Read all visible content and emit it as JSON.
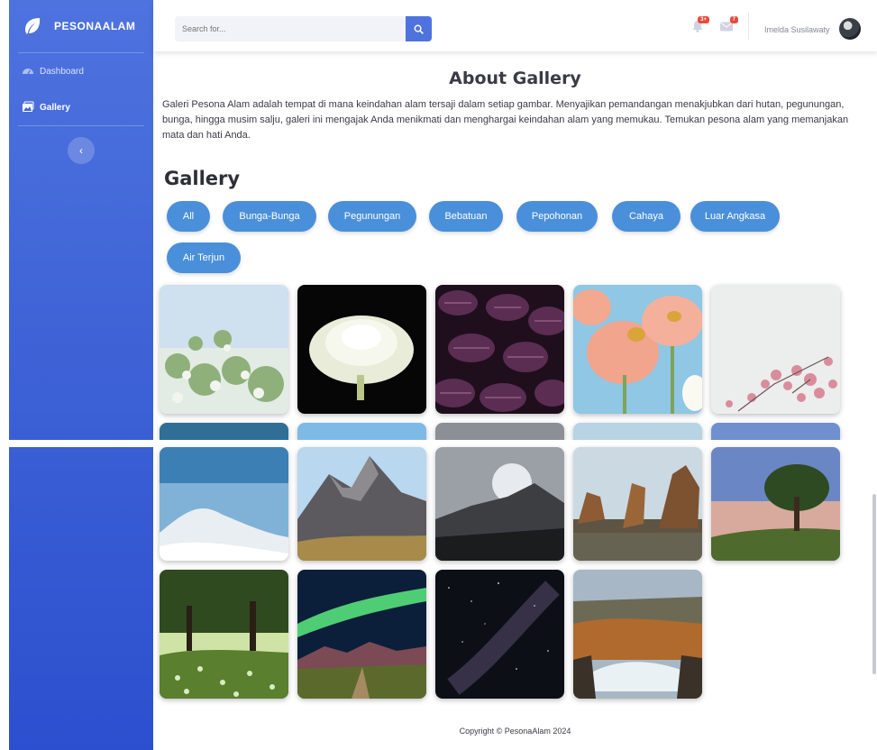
{
  "brand": {
    "name": "PESONAALAM"
  },
  "sidebar": {
    "items": [
      {
        "label": "Dashboard",
        "icon": "dashboard-icon"
      },
      {
        "label": "Gallery",
        "icon": "gallery-icon"
      }
    ],
    "toggle": "‹"
  },
  "topbar": {
    "search_placeholder": "Search for...",
    "alerts_count": "3+",
    "messages_count": "7",
    "user_name": "Imelda Susilawaty"
  },
  "about": {
    "title": "About Gallery",
    "text": "Galeri Pesona Alam adalah tempat di mana keindahan alam tersaji dalam setiap gambar. Menyajikan pemandangan menakjubkan dari hutan, pegunungan, bunga, hingga musim salju, galeri ini mengajak Anda menikmati dan menghargai keindahan alam yang memukau. Temukan pesona alam yang memanjakan mata dan hati Anda."
  },
  "gallery": {
    "title": "Gallery",
    "filters": [
      "All",
      "Bunga-Bunga",
      "Pegunungan",
      "Bebatuan",
      "Pepohonan",
      "Cahaya",
      "Luar Angkasa",
      "Air Terjun"
    ]
  },
  "footer": {
    "copyright": "Copyright © PesonaAlam 2024"
  },
  "colors": {
    "primary": "#4e73df",
    "filter_button": "#4a8fd9",
    "badge": "#e74a3b"
  }
}
